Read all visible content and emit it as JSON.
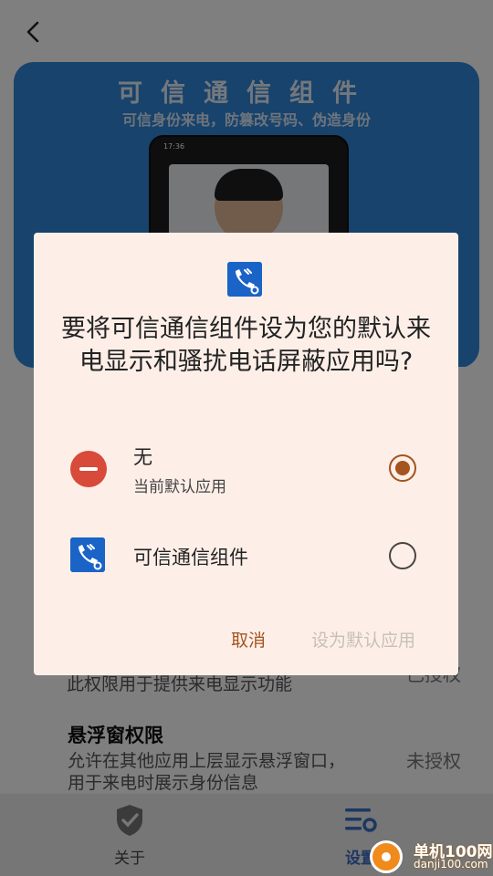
{
  "banner": {
    "title": "可信通信组件",
    "subtitle": "可信身份来电，防篡改号码、伪造身份",
    "phone_time": "17:36"
  },
  "background_permissions": [
    {
      "description": "此权限用于提供来电显示功能",
      "status": "已授权"
    },
    {
      "title": "悬浮窗权限",
      "description": "允许在其他应用上层显示悬浮窗口，用于来电时展示身份信息",
      "status": "未授权"
    }
  ],
  "tabbar": {
    "tabs": [
      {
        "label": "关于",
        "icon": "shield-check-icon"
      },
      {
        "label": "设置",
        "icon": "settings-list-icon"
      }
    ]
  },
  "dialog": {
    "question": "要将可信通信组件设为您的默认来电显示和骚扰电话屏蔽应用吗?",
    "options": [
      {
        "title": "无",
        "subtitle": "当前默认应用",
        "selected": true,
        "icon": "none-icon"
      },
      {
        "title": "可信通信组件",
        "selected": false,
        "icon": "trusted-call-app-icon"
      }
    ],
    "cancel_label": "取消",
    "set_default_label": "设为默认应用"
  },
  "watermark": {
    "line1": "单机100网",
    "line2": "danji100.com"
  },
  "colors": {
    "accent": "#a5531f",
    "dialog_bg": "#fdefe8",
    "banner_blue": "#2f86d8"
  }
}
